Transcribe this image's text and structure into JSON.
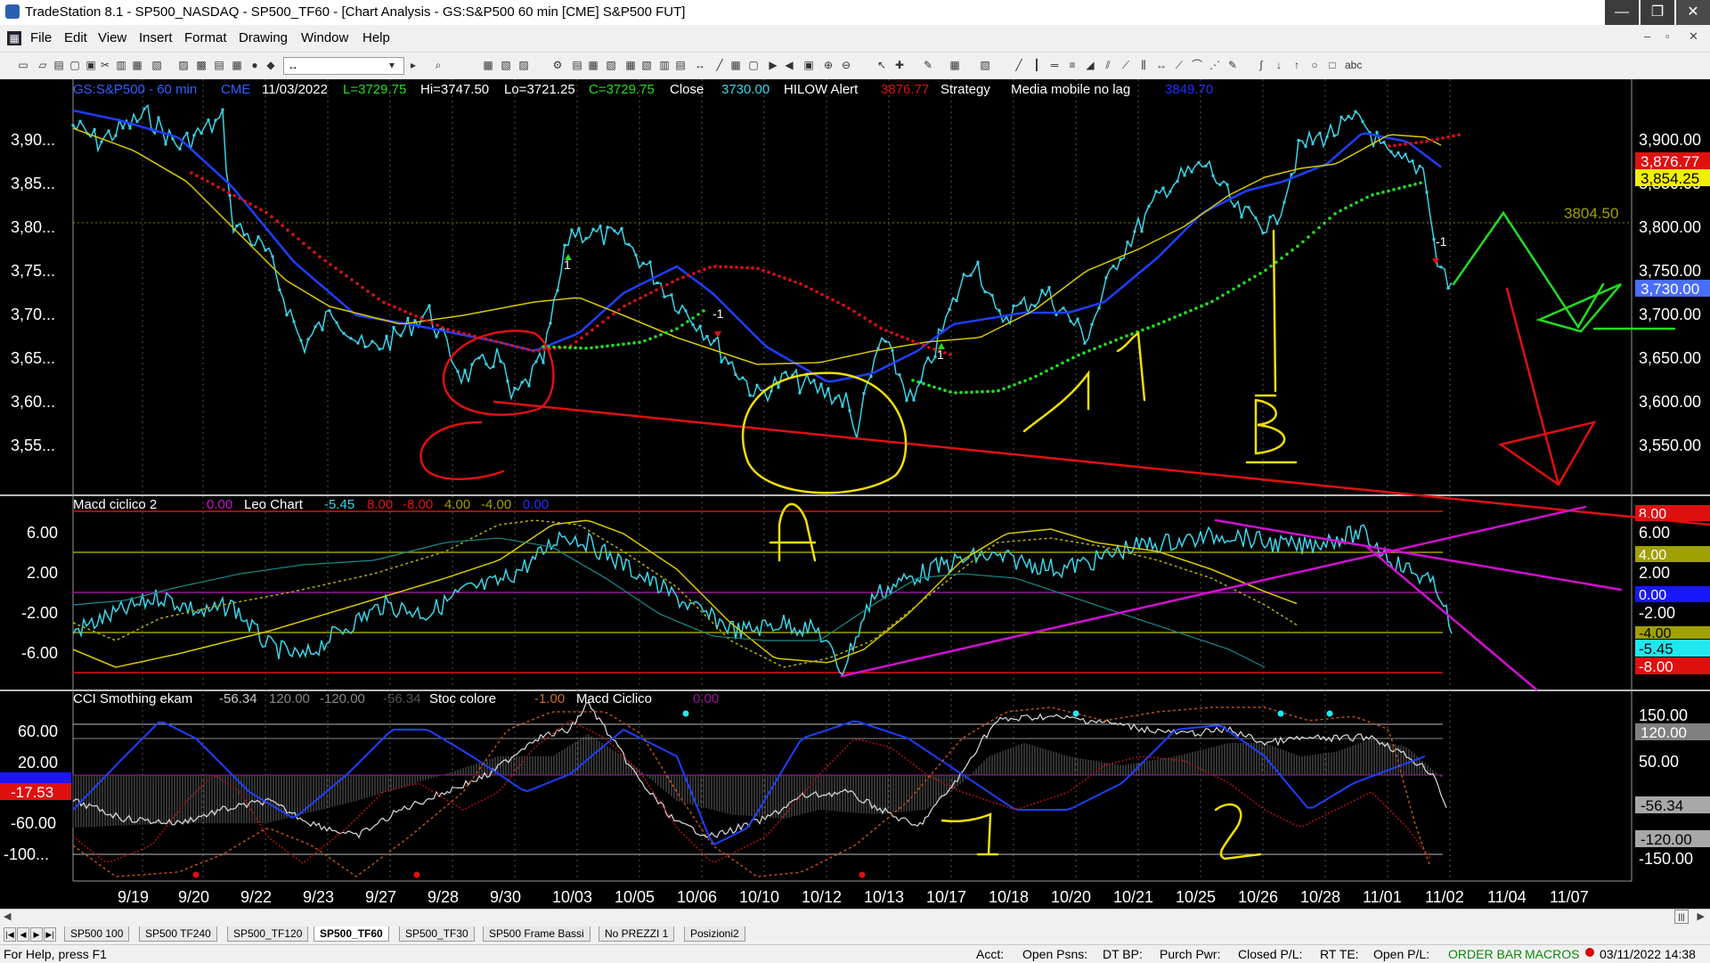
{
  "window": {
    "title": "TradeStation 8.1 - SP500_NASDAQ - SP500_TF60 - [Chart Analysis - GS:S&P500  60 min  [CME] S&P500 FUT]",
    "controls": [
      "—",
      "❐",
      "✕"
    ]
  },
  "menu": {
    "items": [
      "File",
      "Edit",
      "View",
      "Insert",
      "Format",
      "Drawing",
      "Window",
      "Help"
    ],
    "doc_controls": [
      "–",
      "▫",
      "✕"
    ]
  },
  "toolbar": {
    "combo_value": "↔"
  },
  "chart": {
    "price_header": {
      "symbol": "GS:S&P500 - 60 min",
      "exchange": "CME",
      "date": "11/03/2022",
      "last": "L=3729.75",
      "high": "Hi=3747.50",
      "low": "Lo=3721.25",
      "close": "C=3729.75",
      "close_label": "Close",
      "close_val": "3730.00",
      "hilow_label": "HILOW Alert",
      "hilow_val": "3876.77",
      "strategy_label": "Strategy",
      "media_label": "Media mobile no lag",
      "media_val": "3849.70"
    },
    "price_axis_labels": [
      "3,90...",
      "3,85...",
      "3,80...",
      "3,75...",
      "3,70...",
      "3,65...",
      "3,60...",
      "3,55..."
    ],
    "price_right_labels": [
      "3,900.00",
      "3,850.00",
      "3,800.00",
      "3,750.00",
      "3,700.00",
      "3,650.00",
      "3,600.00",
      "3,550.00"
    ],
    "price_right_badges": {
      "red": "3,876.77",
      "yellow": "3,854.25",
      "blue": "3,730.00",
      "olive": "3804.50"
    },
    "macd_header": {
      "name": "Macd ciclico 2",
      "v1": "0.00",
      "leo": "Leo Chart",
      "v2": "-5.45",
      "v3": "8.00",
      "v4": "-8.00",
      "v5": "4.00",
      "v6": "-4.00",
      "v7": "0.00"
    },
    "macd_axis_labels": [
      "6.00",
      "2.00",
      "-2.00",
      "-6.00"
    ],
    "macd_right_labels": [
      "6.00",
      "2.00",
      "-2.00"
    ],
    "macd_badges": {
      "r8": "8.00",
      "y4": "4.00",
      "b0": "0.00",
      "o4": "-4.00",
      "c545": "-5.45",
      "r8n": "-8.00"
    },
    "cci_header": {
      "name": "CCI Smothing ekam",
      "v1": "-56.34",
      "v2": "120.00",
      "v3": "-120.00",
      "v4": "-56.34",
      "stoc": "Stoc colore",
      "v5": "-1.00",
      "macd": "Macd Ciclico",
      "v6": "0.00"
    },
    "cci_axis_labels": [
      "60.00",
      "20.00",
      "-60.00",
      "-100..."
    ],
    "cci_left_badge": "-17.53",
    "cci_right_labels": [
      "150.00",
      "50.00",
      "-150.00"
    ],
    "cci_badges": {
      "g120": "120.00",
      "g5634": "-56.34",
      "gn120": "-120.00"
    },
    "dates": [
      "9/19",
      "9/20",
      "9/22",
      "9/23",
      "9/27",
      "9/28",
      "9/30",
      "10/03",
      "10/05",
      "10/06",
      "10/10",
      "10/12",
      "10/13",
      "10/17",
      "10/18",
      "10/20",
      "10/21",
      "10/25",
      "10/26",
      "10/28",
      "11/01",
      "11/02",
      "11/04",
      "11/07"
    ],
    "annotations": {
      "a": "A",
      "b": "B",
      "one": "1",
      "two": "2",
      "c": "C"
    },
    "signal_labels": {
      "up": "1",
      "down": "-1"
    },
    "colors": {
      "price": "#3ad4e8",
      "blue_ma": "#1f3fff",
      "yellow_ma": "#d8c800",
      "red_dots": "#e01010",
      "green_dots": "#22e022",
      "magenta": "#d010d0",
      "hand_yellow": "#f0e000",
      "hand_red": "#e01010",
      "hand_green": "#22dd22"
    }
  },
  "tabs": {
    "items": [
      "SP500 100",
      "SP500 TF240",
      "SP500_TF120",
      "SP500_TF60",
      "SP500_TF30",
      "SP500 Frame Bassi",
      "No PREZZI 1",
      "Posizioni2"
    ],
    "active": "SP500_TF60"
  },
  "status": {
    "help": "For Help, press F1",
    "acct": "Acct:",
    "open_psns": "Open Psns:",
    "dt_bp": "DT BP:",
    "purch_pwr": "Purch Pwr:",
    "closed_pl": "Closed P/L:",
    "rt_te": "RT TE:",
    "open_pl": "Open P/L:",
    "order_bar": "ORDER BAR",
    "macros": "MACROS",
    "datetime": "03/11/2022 14:38"
  }
}
